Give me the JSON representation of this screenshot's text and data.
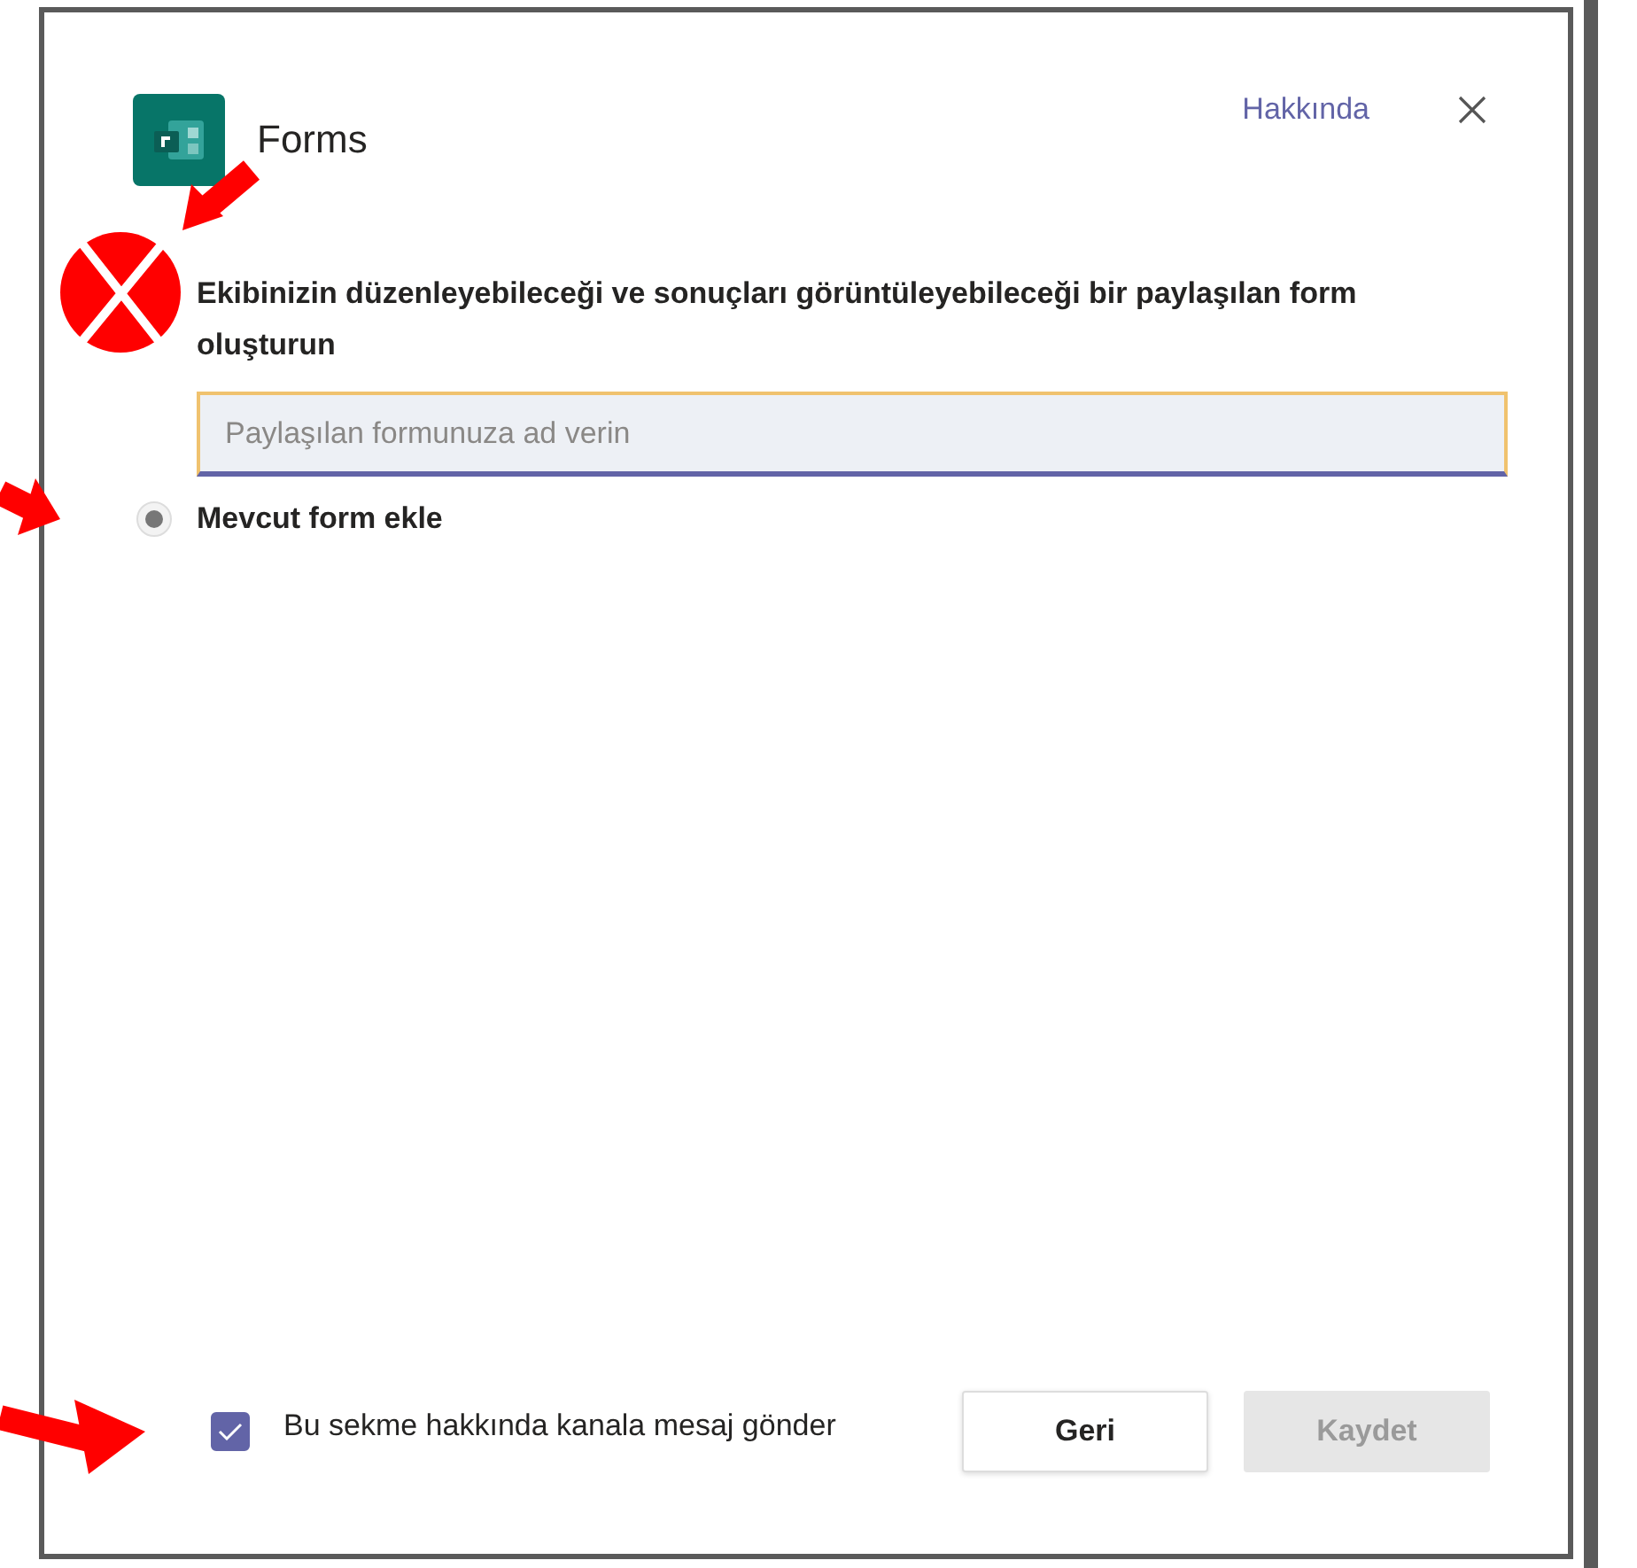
{
  "dialog": {
    "title": "Forms",
    "about_link": "Hakkında"
  },
  "description": "Ekibinizin düzenleyebileceği ve sonuçları görüntüleyebileceği bir paylaşılan form oluşturun",
  "name_field": {
    "placeholder": "Paylaşılan formunuza ad verin"
  },
  "options": [
    {
      "label": "Mevcut form ekle",
      "selected": true
    }
  ],
  "post_message": {
    "label": "Bu sekme hakkında kanala mesaj gönder",
    "checked": true
  },
  "buttons": [
    {
      "label": "Geri",
      "disabled": false
    },
    {
      "label": "Kaydet",
      "disabled": true
    }
  ]
}
